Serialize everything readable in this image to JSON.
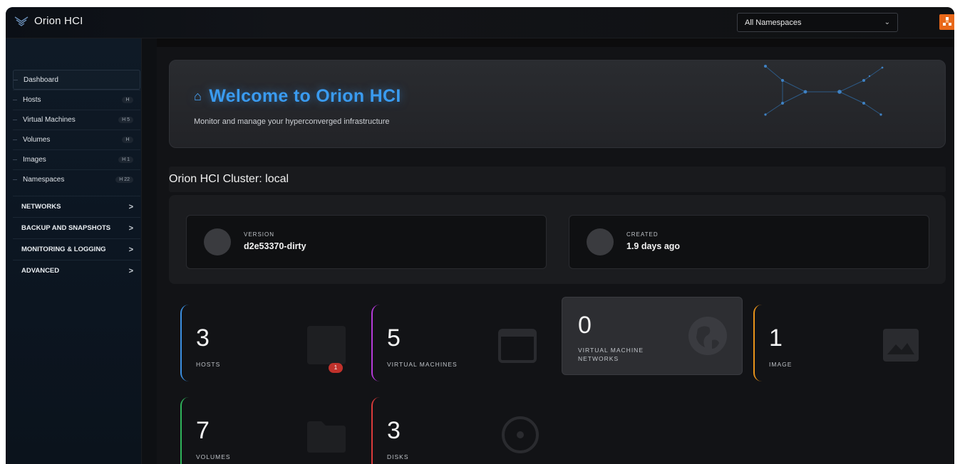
{
  "app": {
    "title": "Orion HCI",
    "namespace_select": "All Namespaces"
  },
  "sidebar": {
    "items": [
      {
        "label": "Dashboard",
        "badge": ""
      },
      {
        "label": "Hosts",
        "badge": "H"
      },
      {
        "label": "Virtual Machines",
        "badge": "H 5"
      },
      {
        "label": "Volumes",
        "badge": "H"
      },
      {
        "label": "Images",
        "badge": "H 1"
      },
      {
        "label": "Namespaces",
        "badge": "H 22"
      }
    ],
    "sections": [
      {
        "label": "NETWORKS",
        "arrow": ">"
      },
      {
        "label": "BACKUP AND SNAPSHOTS",
        "arrow": ">"
      },
      {
        "label": "MONITORING & LOGGING",
        "arrow": ">"
      },
      {
        "label": "ADVANCED",
        "arrow": ">"
      }
    ]
  },
  "welcome": {
    "title": "Welcome to Orion HCI",
    "subtitle": "Monitor and manage your hyperconverged infrastructure"
  },
  "cluster": {
    "title": "Orion HCI Cluster: local",
    "version_label": "VERSION",
    "version_value": "d2e53370-dirty",
    "created_label": "CREATED",
    "created_value": "1.9 days ago"
  },
  "stats": [
    {
      "value": "3",
      "label": "HOSTS",
      "accent": "#3b8fe0",
      "icon": "host-icon",
      "alert": "1"
    },
    {
      "value": "5",
      "label": "VIRTUAL MACHINES",
      "accent": "#b43ad8",
      "icon": "vm-icon"
    },
    {
      "value": "0",
      "label": "VIRTUAL MACHINE NETWORKS",
      "accent": "",
      "icon": "globe-icon"
    },
    {
      "value": "1",
      "label": "IMAGE",
      "accent": "#e8931a",
      "icon": "image-icon"
    },
    {
      "value": "7",
      "label": "VOLUMES",
      "accent": "#2fb35a",
      "icon": "folder-icon"
    },
    {
      "value": "3",
      "label": "DISKS",
      "accent": "#d93a3a",
      "icon": "disk-icon"
    }
  ]
}
